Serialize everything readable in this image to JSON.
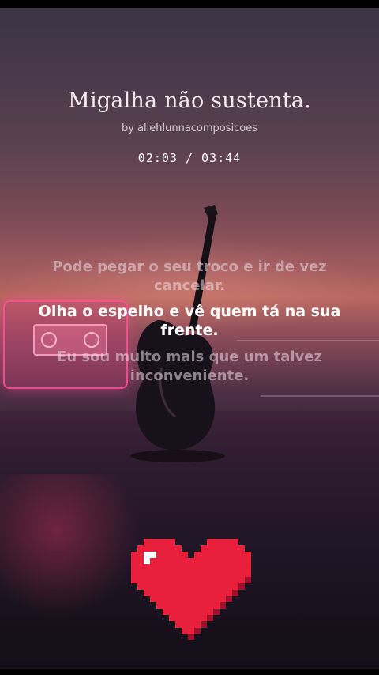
{
  "song": {
    "title": "Migalha não sustenta.",
    "author": "by allehlunnacomposicoes",
    "time": "02:03 / 03:44"
  },
  "lyrics": {
    "previous": "Pode pegar o seu troco e ir de vez cancelar.",
    "current": "Olha o espelho e vê quem tá na sua frente.",
    "next": "Eu sou muito mais que um talvez inconveniente."
  },
  "colors": {
    "heart": "#e8203c",
    "heart_highlight": "#ffffff",
    "heart_shadow": "#a01028",
    "neon": "#ff50a0"
  },
  "icons": [
    "cassette-tape-icon",
    "guitar-icon",
    "pixel-heart-icon"
  ]
}
